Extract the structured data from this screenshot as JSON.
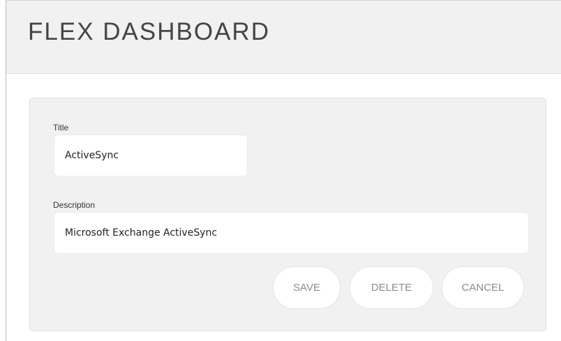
{
  "header": {
    "title": "FLEX DASHBOARD"
  },
  "form": {
    "title_label": "Title",
    "title_value": "ActiveSync",
    "description_label": "Description",
    "description_value": "Microsoft Exchange ActiveSync"
  },
  "actions": {
    "save_label": "SAVE",
    "delete_label": "DELETE",
    "cancel_label": "CANCEL"
  },
  "colors": {
    "header_background": "#f1f1f1",
    "panel_background": "#f1f1f1",
    "button_text": "#8c8c8c",
    "title_text": "#454545"
  }
}
